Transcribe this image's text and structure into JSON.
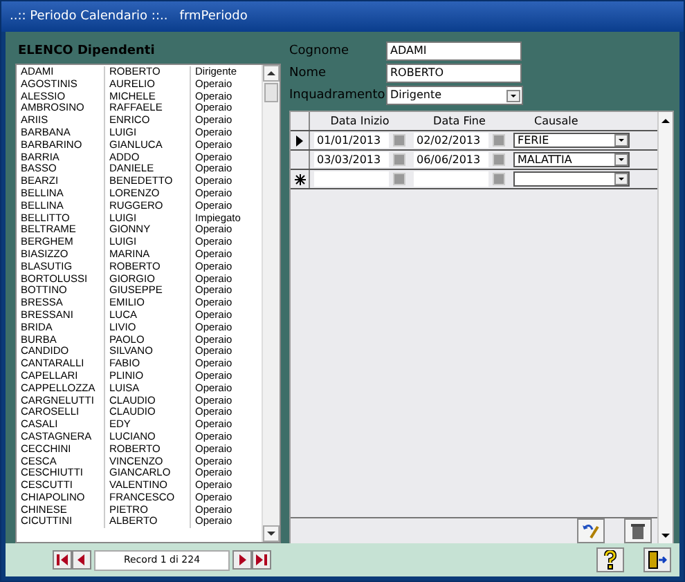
{
  "window": {
    "title": "..:: Periodo Calendario ::..   frmPeriodo"
  },
  "list": {
    "heading": "ELENCO Dipendenti",
    "rows": [
      {
        "surname": "ADAMI",
        "name": "ROBERTO",
        "role": "Dirigente"
      },
      {
        "surname": "AGOSTINIS",
        "name": "AURELIO",
        "role": "Operaio"
      },
      {
        "surname": "ALESSIO",
        "name": "MICHELE",
        "role": "Operaio"
      },
      {
        "surname": "AMBROSINO",
        "name": "RAFFAELE",
        "role": "Operaio"
      },
      {
        "surname": "ARIIS",
        "name": "ENRICO",
        "role": "Operaio"
      },
      {
        "surname": "BARBANA",
        "name": "LUIGI",
        "role": "Operaio"
      },
      {
        "surname": "BARBARINO",
        "name": "GIANLUCA",
        "role": "Operaio"
      },
      {
        "surname": "BARRIA",
        "name": "ADDO",
        "role": "Operaio"
      },
      {
        "surname": "BASSO",
        "name": "DANIELE",
        "role": "Operaio"
      },
      {
        "surname": "BEARZI",
        "name": "BENEDETTO",
        "role": "Operaio"
      },
      {
        "surname": "BELLINA",
        "name": "LORENZO",
        "role": "Operaio"
      },
      {
        "surname": "BELLINA",
        "name": "RUGGERO",
        "role": "Operaio"
      },
      {
        "surname": "BELLITTO",
        "name": "LUIGI",
        "role": "Impiegato"
      },
      {
        "surname": "BELTRAME",
        "name": "GIONNY",
        "role": "Operaio"
      },
      {
        "surname": "BERGHEM",
        "name": "LUIGI",
        "role": "Operaio"
      },
      {
        "surname": "BIASIZZO",
        "name": "MARINA",
        "role": "Operaio"
      },
      {
        "surname": "BLASUTIG",
        "name": "ROBERTO",
        "role": "Operaio"
      },
      {
        "surname": "BORTOLUSSI",
        "name": "GIORGIO",
        "role": "Operaio"
      },
      {
        "surname": "BOTTINO",
        "name": "GIUSEPPE",
        "role": "Operaio"
      },
      {
        "surname": "BRESSA",
        "name": "EMILIO",
        "role": "Operaio"
      },
      {
        "surname": "BRESSANI",
        "name": "LUCA",
        "role": "Operaio"
      },
      {
        "surname": "BRIDA",
        "name": "LIVIO",
        "role": "Operaio"
      },
      {
        "surname": "BURBA",
        "name": "PAOLO",
        "role": "Operaio"
      },
      {
        "surname": "CANDIDO",
        "name": "SILVANO",
        "role": "Operaio"
      },
      {
        "surname": "CANTARALLI",
        "name": "FABIO",
        "role": "Operaio"
      },
      {
        "surname": "CAPELLARI",
        "name": "PLINIO",
        "role": "Operaio"
      },
      {
        "surname": "CAPPELLOZZA",
        "name": "LUISA",
        "role": "Operaio"
      },
      {
        "surname": "CARGNELUTTI",
        "name": "CLAUDIO",
        "role": "Operaio"
      },
      {
        "surname": "CAROSELLI",
        "name": "CLAUDIO",
        "role": "Operaio"
      },
      {
        "surname": "CASALI",
        "name": "EDY",
        "role": "Operaio"
      },
      {
        "surname": "CASTAGNERA",
        "name": "LUCIANO",
        "role": "Operaio"
      },
      {
        "surname": "CECCHINI",
        "name": "ROBERTO",
        "role": "Operaio"
      },
      {
        "surname": "CESCA",
        "name": "VINCENZO",
        "role": "Operaio"
      },
      {
        "surname": "CESCHIUTTI",
        "name": "GIANCARLO",
        "role": "Operaio"
      },
      {
        "surname": "CESCUTTI",
        "name": "VALENTINO",
        "role": "Operaio"
      },
      {
        "surname": "CHIAPOLINO",
        "name": "FRANCESCO",
        "role": "Operaio"
      },
      {
        "surname": "CHINESE",
        "name": "PIETRO",
        "role": "Operaio"
      },
      {
        "surname": "CICUTTINI",
        "name": "ALBERTO",
        "role": "Operaio"
      }
    ]
  },
  "form": {
    "cognome_label": "Cognome",
    "cognome": "ADAMI",
    "nome_label": "Nome",
    "nome": "ROBERTO",
    "inquadramento_label": "Inquadramento",
    "inquadramento": "Dirigente"
  },
  "periods": {
    "columns": [
      "Data Inizio",
      "Data Fine",
      "Causale"
    ],
    "rows": [
      {
        "kind": "current",
        "start": "01/01/2013",
        "end": "02/02/2013",
        "causale": "FERIE"
      },
      {
        "kind": "data",
        "start": "03/03/2013",
        "end": "06/06/2013",
        "causale": "MALATTIA"
      },
      {
        "kind": "new"
      }
    ]
  },
  "navigation": {
    "record": "Record 1 di 224"
  }
}
